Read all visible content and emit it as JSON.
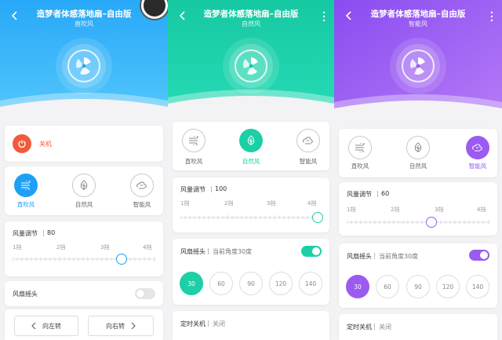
{
  "colors": {
    "blue": "#1ea0f5",
    "teal": "#1ccfa6",
    "purple": "#9b5bf0",
    "red": "#f25a3c"
  },
  "panels": [
    {
      "title": "造梦者体感落地扇–自由版",
      "subtitle": "直吹风",
      "power_label": "关机",
      "modes": [
        {
          "label": "直吹风",
          "active": true
        },
        {
          "label": "自然风",
          "active": false
        },
        {
          "label": "智能风",
          "active": false
        }
      ],
      "speed": {
        "label": "风量调节",
        "value": "80",
        "ticks": [
          "1挡",
          "2挡",
          "3挡",
          "4挡"
        ]
      },
      "oscillate": {
        "label": "风扇摇头",
        "on": false
      },
      "turn_left": "向左转",
      "turn_right": "向右转"
    },
    {
      "title": "造梦者体感落地扇–自由版",
      "subtitle": "自然风",
      "modes": [
        {
          "label": "直吹风",
          "active": false
        },
        {
          "label": "自然风",
          "active": true
        },
        {
          "label": "智能风",
          "active": false
        }
      ],
      "speed": {
        "label": "风量调节",
        "value": "100",
        "ticks": [
          "1挡",
          "2挡",
          "3挡",
          "4挡"
        ]
      },
      "oscillate": {
        "label": "风扇摇头",
        "angle_text": "当前角度30度",
        "on": true
      },
      "angles": [
        "30",
        "60",
        "90",
        "120",
        "140"
      ],
      "timer": {
        "label": "定时关机",
        "value": "关闭"
      }
    },
    {
      "title": "造梦者体感落地扇–自由版",
      "subtitle": "智能风",
      "modes": [
        {
          "label": "直吹风",
          "active": false
        },
        {
          "label": "自然风",
          "active": false
        },
        {
          "label": "智能风",
          "active": true
        }
      ],
      "speed": {
        "label": "风量调节",
        "value": "60",
        "ticks": [
          "1挡",
          "2挡",
          "3挡",
          "4挡"
        ]
      },
      "oscillate": {
        "label": "风扇摇头",
        "angle_text": "当前角度30度",
        "on": true
      },
      "angles": [
        "30",
        "60",
        "90",
        "120",
        "140"
      ],
      "timer": {
        "label": "定时关机",
        "value": "关闭"
      }
    }
  ],
  "icons": [
    "back-arrow-icon",
    "more-dots-icon",
    "fan-logo-icon",
    "power-icon",
    "direct-wind-icon",
    "leaf-icon",
    "smart-wind-icon",
    "chevron-left-icon",
    "chevron-right-icon"
  ]
}
